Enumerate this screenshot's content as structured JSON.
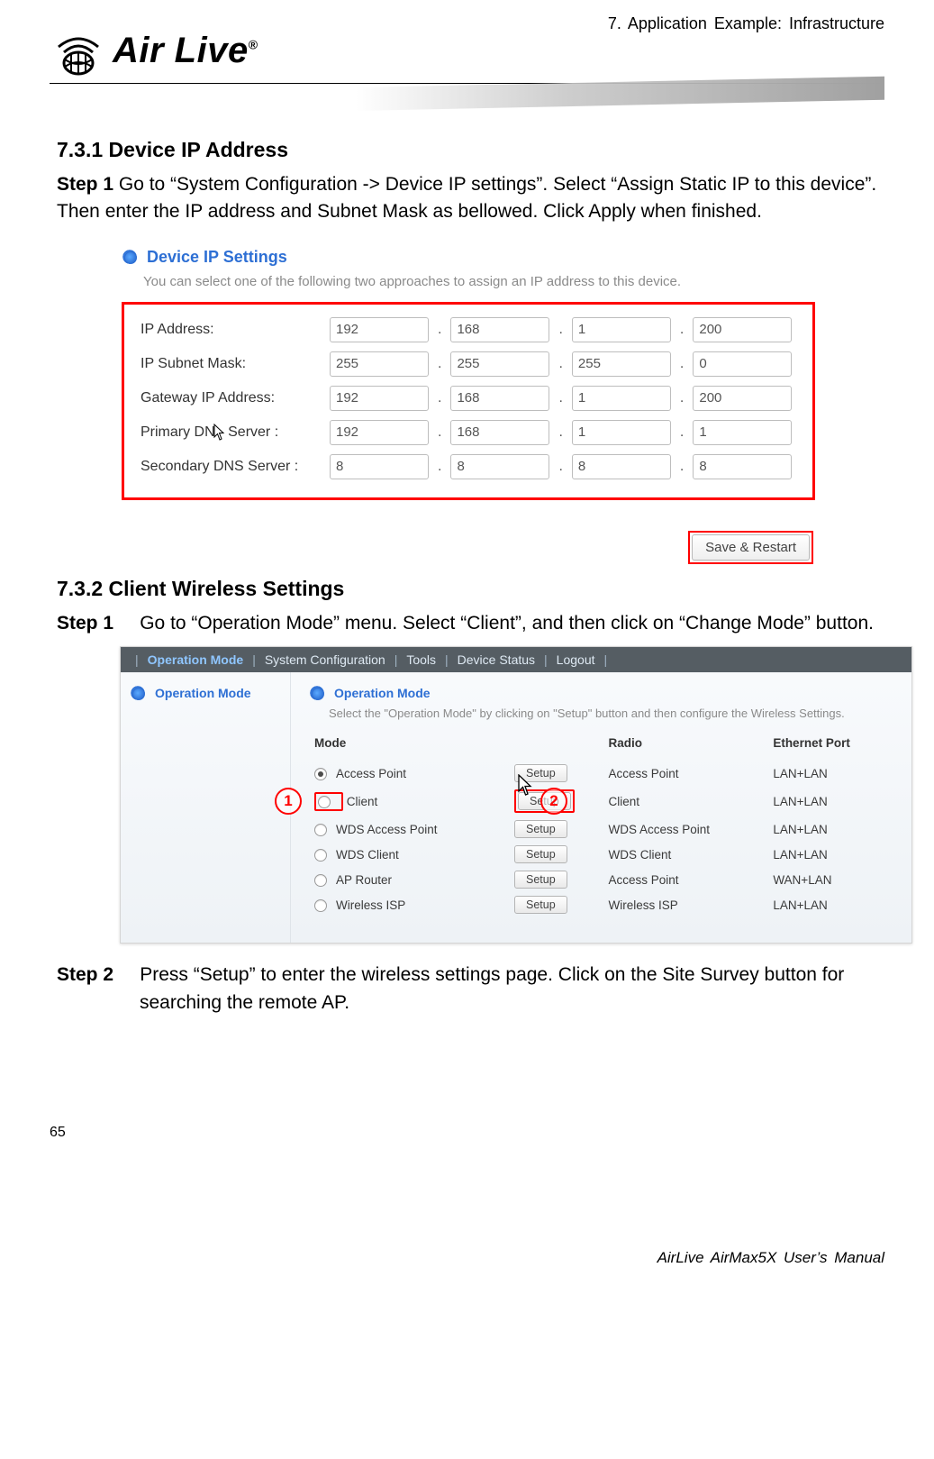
{
  "header": {
    "chapter": "7.  Application  Example:  Infrastructure",
    "logo_text": "Air Live"
  },
  "section731": {
    "heading": "7.3.1 Device IP Address",
    "step1_label": "Step 1",
    "step1_text": "   Go to “System Configuration -> Device IP settings”. Select “Assign Static IP to this device”. Then enter the IP address and Subnet Mask as bellowed. Click Apply when finished."
  },
  "ip_panel": {
    "title": "Device IP Settings",
    "subtitle": "You can select one of the following two approaches to assign an IP address to this device.",
    "rows": [
      {
        "label": "IP Address:",
        "octets": [
          "192",
          "168",
          "1",
          "200"
        ]
      },
      {
        "label": "IP Subnet Mask:",
        "octets": [
          "255",
          "255",
          "255",
          "0"
        ]
      },
      {
        "label": "Gateway IP Address:",
        "octets": [
          "192",
          "168",
          "1",
          "200"
        ]
      },
      {
        "label": "Primary DN",
        "label2": " Server :",
        "octets": [
          "192",
          "168",
          "1",
          "1"
        ],
        "cursor": true
      },
      {
        "label": "Secondary DNS Server :",
        "octets": [
          "8",
          "8",
          "8",
          "8"
        ]
      }
    ],
    "save_label": "Save & Restart"
  },
  "section732": {
    "heading": "7.3.2 Client Wireless Settings",
    "step1_label": "Step 1",
    "step1_text": "Go to “Operation Mode” menu. Select “Client”, and then click on “Change Mode” button.",
    "step2_label": "Step 2",
    "step2_text": "Press “Setup” to enter the wireless settings page. Click on the Site Survey button for searching the remote AP."
  },
  "opmode": {
    "nav": [
      "Operation Mode",
      "System Configuration",
      "Tools",
      "Device Status",
      "Logout"
    ],
    "side_title": "Operation Mode",
    "main_title": "Operation Mode",
    "subtitle": "Select the \"Operation Mode\" by clicking on \"Setup\" button and then configure the Wireless Settings.",
    "th_mode": "Mode",
    "th_radio": "Radio",
    "th_eth": "Ethernet Port",
    "setup_label": "Setup",
    "rows": [
      {
        "mode": "Access Point",
        "radio": "Access Point",
        "eth": "LAN+LAN",
        "selected": true
      },
      {
        "mode": "Client",
        "radio": "Client",
        "eth": "LAN+LAN"
      },
      {
        "mode": "WDS Access Point",
        "radio": "WDS Access Point",
        "eth": "LAN+LAN"
      },
      {
        "mode": "WDS Client",
        "radio": "WDS Client",
        "eth": "LAN+LAN"
      },
      {
        "mode": "AP Router",
        "radio": "Access Point",
        "eth": "WAN+LAN"
      },
      {
        "mode": "Wireless ISP",
        "radio": "Wireless ISP",
        "eth": "LAN+LAN"
      }
    ],
    "circ1": "1",
    "circ2": "2"
  },
  "footer": {
    "page_no": "65",
    "manual": "AirLive  AirMax5X  User’s  Manual"
  }
}
